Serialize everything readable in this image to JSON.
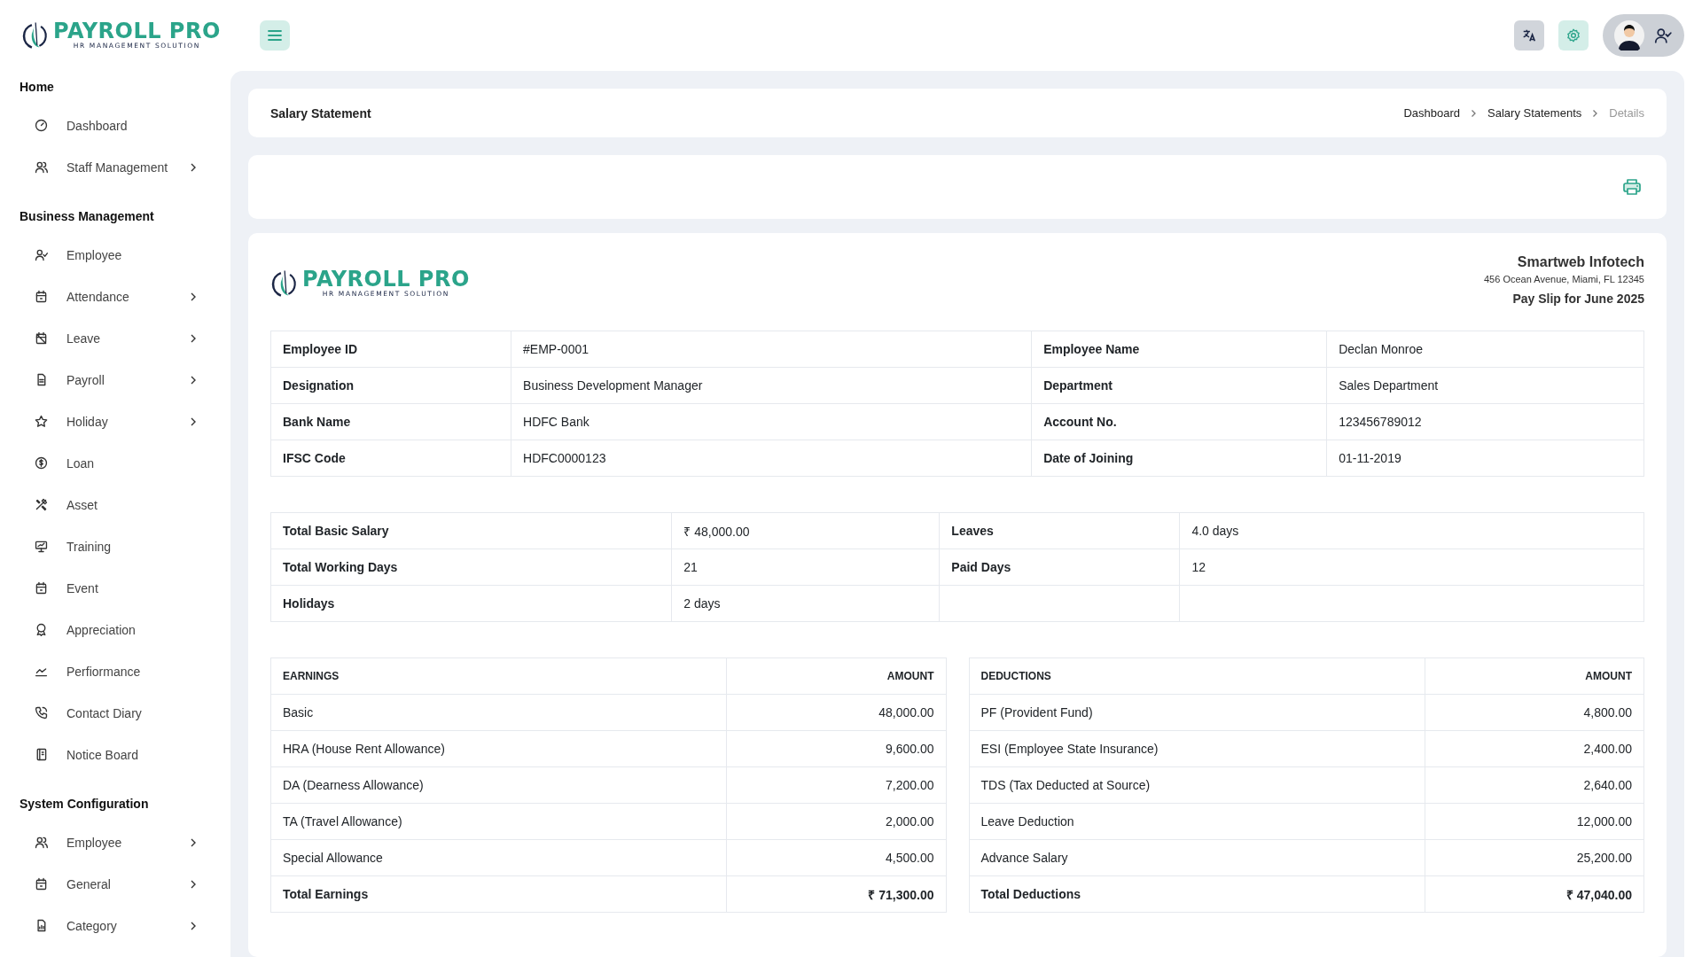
{
  "header": {
    "logo": {
      "title": "PAYROLL PRO",
      "subtitle": "HR MANAGEMENT SOLUTION"
    }
  },
  "sidebar": {
    "sections": [
      {
        "title": "Home",
        "items": [
          {
            "label": "Dashboard",
            "has_submenu": false
          },
          {
            "label": "Staff Management",
            "has_submenu": true
          }
        ]
      },
      {
        "title": "Business Management",
        "items": [
          {
            "label": "Employee",
            "has_submenu": false
          },
          {
            "label": "Attendance",
            "has_submenu": true
          },
          {
            "label": "Leave",
            "has_submenu": true
          },
          {
            "label": "Payroll",
            "has_submenu": true
          },
          {
            "label": "Holiday",
            "has_submenu": true
          },
          {
            "label": "Loan",
            "has_submenu": false
          },
          {
            "label": "Asset",
            "has_submenu": false
          },
          {
            "label": "Training",
            "has_submenu": false
          },
          {
            "label": "Event",
            "has_submenu": false
          },
          {
            "label": "Appreciation",
            "has_submenu": false
          },
          {
            "label": "Perfiormance",
            "has_submenu": false
          },
          {
            "label": "Contact Diary",
            "has_submenu": false
          },
          {
            "label": "Notice Board",
            "has_submenu": false
          }
        ]
      },
      {
        "title": "System Configuration",
        "items": [
          {
            "label": "Employee",
            "has_submenu": true
          },
          {
            "label": "General",
            "has_submenu": true
          },
          {
            "label": "Category",
            "has_submenu": true
          }
        ]
      }
    ]
  },
  "page": {
    "title": "Salary Statement",
    "breadcrumbs": [
      {
        "label": "Dashboard",
        "current": false
      },
      {
        "label": "Salary Statements",
        "current": false
      },
      {
        "label": "Details",
        "current": true
      }
    ]
  },
  "payslip": {
    "logo": {
      "title": "PAYROLL PRO",
      "subtitle": "HR MANAGEMENT SOLUTION"
    },
    "company": {
      "name": "Smartweb Infotech",
      "address": "456 Ocean Avenue, Miami, FL 12345",
      "period": "Pay Slip for June 2025"
    },
    "employee_details": [
      [
        {
          "label": "Employee ID",
          "value": "#EMP-0001"
        },
        {
          "label": "Employee Name",
          "value": "Declan Monroe"
        }
      ],
      [
        {
          "label": "Designation",
          "value": "Business Development Manager"
        },
        {
          "label": "Department",
          "value": "Sales Department"
        }
      ],
      [
        {
          "label": "Bank Name",
          "value": "HDFC Bank"
        },
        {
          "label": "Account No.",
          "value": "123456789012"
        }
      ],
      [
        {
          "label": "IFSC Code",
          "value": "HDFC0000123"
        },
        {
          "label": "Date of Joining",
          "value": "01-11-2019"
        }
      ]
    ],
    "attendance_summary": [
      [
        {
          "label": "Total Basic Salary",
          "value": "₹ 48,000.00"
        },
        {
          "label": "Leaves",
          "value": "4.0 days"
        }
      ],
      [
        {
          "label": "Total Working Days",
          "value": "21"
        },
        {
          "label": "Paid Days",
          "value": "12"
        }
      ],
      [
        {
          "label": "Holidays",
          "value": "2 days"
        }
      ]
    ],
    "earnings": {
      "columns": [
        "EARNINGS",
        "AMOUNT"
      ],
      "rows": [
        {
          "name": "Basic",
          "amount": "48,000.00"
        },
        {
          "name": "HRA (House Rent Allowance)",
          "amount": "9,600.00"
        },
        {
          "name": "DA (Dearness Allowance)",
          "amount": "7,200.00"
        },
        {
          "name": "TA (Travel Allowance)",
          "amount": "2,000.00"
        },
        {
          "name": "Special Allowance",
          "amount": "4,500.00"
        }
      ],
      "total": {
        "name": "Total Earnings",
        "amount": "₹ 71,300.00"
      }
    },
    "deductions": {
      "columns": [
        "DEDUCTIONS",
        "AMOUNT"
      ],
      "rows": [
        {
          "name": "PF (Provident Fund)",
          "amount": "4,800.00"
        },
        {
          "name": "ESI (Employee State Insurance)",
          "amount": "2,400.00"
        },
        {
          "name": "TDS (Tax Deducted at Source)",
          "amount": "2,640.00"
        },
        {
          "name": "Leave Deduction",
          "amount": "12,000.00"
        },
        {
          "name": "Advance Salary",
          "amount": "25,200.00"
        }
      ],
      "total": {
        "name": "Total Deductions",
        "amount": "₹ 47,040.00"
      }
    }
  }
}
